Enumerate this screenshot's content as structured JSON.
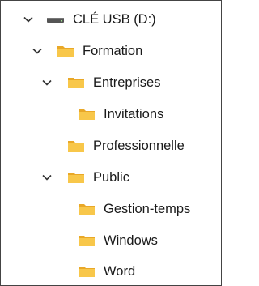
{
  "tree": {
    "drive": {
      "label": "CLÉ USB (D:)",
      "icon": "usb-drive-icon",
      "expanded": true
    },
    "nodes": [
      {
        "label": "Formation",
        "icon": "folder-icon",
        "expanded": true,
        "level": 1
      },
      {
        "label": "Entreprises",
        "icon": "folder-icon",
        "expanded": true,
        "level": 2
      },
      {
        "label": "Invitations",
        "icon": "folder-icon",
        "expanded": false,
        "level": 3
      },
      {
        "label": "Professionnelle",
        "icon": "folder-icon",
        "expanded": false,
        "level": 2
      },
      {
        "label": "Public",
        "icon": "folder-icon",
        "expanded": true,
        "level": 2
      },
      {
        "label": "Gestion-temps",
        "icon": "folder-icon",
        "expanded": false,
        "level": 3
      },
      {
        "label": "Windows",
        "icon": "folder-icon",
        "expanded": false,
        "level": 3
      },
      {
        "label": "Word",
        "icon": "folder-icon",
        "expanded": false,
        "level": 3
      }
    ]
  },
  "colors": {
    "folder_body": "#f8c74a",
    "folder_tab": "#e9a828",
    "chevron": "#333333",
    "drive": "#555555",
    "text": "#1a1a1a"
  }
}
